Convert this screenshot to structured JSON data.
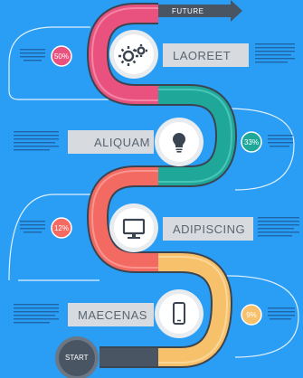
{
  "top_arrow": {
    "label": "FUTURE"
  },
  "start": {
    "label": "START"
  },
  "steps": [
    {
      "label": "LAOREET",
      "percent": "50%",
      "icon": "gears-icon",
      "color": "#e9527f"
    },
    {
      "label": "ALIQUAM",
      "percent": "33%",
      "icon": "lightbulb-icon",
      "color": "#1fa89a"
    },
    {
      "label": "ADIPISCING",
      "percent": "12%",
      "icon": "monitor-icon",
      "color": "#f36a63"
    },
    {
      "label": "MAECENAS",
      "percent": "9%",
      "icon": "smartphone-icon",
      "color": "#f7c06a"
    }
  ],
  "colors": {
    "background": "#2a9df4",
    "label_box": "#d7dbe0",
    "start_circle": "#4a5563"
  }
}
